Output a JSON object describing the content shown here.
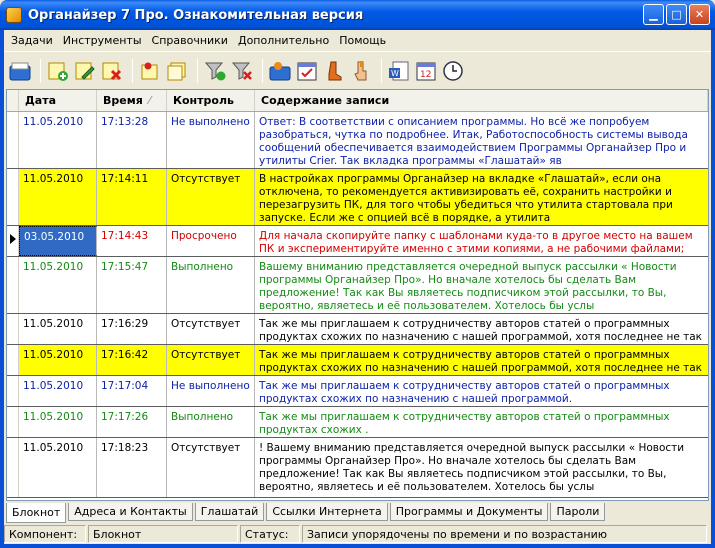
{
  "window": {
    "title": "Органайзер 7 Про. Ознакомительная версия",
    "min_glyph": "▁",
    "max_glyph": "□",
    "close_glyph": "✕"
  },
  "menu": [
    "Задачи",
    "Инструменты",
    "Справочники",
    "Дополнительно",
    "Помощь"
  ],
  "toolbar": {
    "icons": [
      "open-folder-icon",
      "add-note-icon",
      "edit-note-icon",
      "delete-note-icon",
      "pin-note-icon",
      "notes-list-icon",
      "filter-icon",
      "clear-filter-icon",
      "folder-blue-icon",
      "calendar-check-icon",
      "boot-icon",
      "hand-icon",
      "word-export-icon",
      "calendar-12-icon",
      "clock-icon"
    ]
  },
  "grid": {
    "columns": {
      "date": "Дата",
      "time": "Время",
      "control": "Контроль",
      "text": "Содержание записи"
    },
    "sort_glyph": "⁄",
    "rows": [
      {
        "date": "11.05.2010",
        "time": "17:13:28",
        "control": "Не выполнено",
        "text": "Ответ: В соответствии с описанием программы. Но всё же попробуем разобраться, чутка по подробнее. Итак, Работоспособность системы вывода сообщений обеспечивается взаимодействием Программы Органайзер Про и утилиты Crier. Так вкладка программы «Глашатай» яв",
        "color": "blue",
        "highlight": false
      },
      {
        "date": "11.05.2010",
        "time": "17:14:11",
        "control": "Отсутствует",
        "text": "В настройках программы Органайзер на вкладке «Глашатай», если она отключена, то рекомендуется активизировать её, сохранить настройки и перезагрузить ПК, для того чтобы убедиться что утилита стартовала при запуске. Если же с опцией всё в порядке, а утилита",
        "color": "black",
        "highlight": true
      },
      {
        "date": "03.05.2010",
        "time": "17:14:43",
        "control": "Просрочено",
        "text": "Для начала скопируйте папку с шаблонами куда-то в другое место на вашем ПК и экспериментируйте именно с этими копиями, а не рабочими файлами;",
        "color": "red",
        "highlight": false,
        "selected": true
      },
      {
        "date": "11.05.2010",
        "time": "17:15:47",
        "control": "Выполнено",
        "text": "Вашему вниманию представляется очередной выпуск рассылки « Новости программы Органайзер Про». Но вначале хотелось бы сделать Вам предложение! Так как Вы являетесь подписчиком этой рассылки, то Вы, вероятно, являетесь и её пользователем. Хотелось бы услы",
        "color": "green",
        "highlight": false
      },
      {
        "date": "11.05.2010",
        "time": "17:16:29",
        "control": "Отсутствует",
        "text": "Так же мы приглашаем к сотрудничеству авторов статей о программных продуктах схожих по назначению  с нашей программой, хотя последнее не так важно.",
        "color": "black",
        "highlight": false
      },
      {
        "date": "11.05.2010",
        "time": "17:16:42",
        "control": "Отсутствует",
        "text": "Так же мы приглашаем к сотрудничеству авторов статей о программных продуктах схожих по назначению  с нашей программой, хотя последнее не так важно.",
        "color": "black",
        "highlight": true
      },
      {
        "date": "11.05.2010",
        "time": "17:17:04",
        "control": "Не выполнено",
        "text": "Так же мы приглашаем к сотрудничеству авторов статей о программных продуктах схожих по назначению  с нашей программой.",
        "color": "blue",
        "highlight": false
      },
      {
        "date": "11.05.2010",
        "time": "17:17:26",
        "control": "Выполнено",
        "text": "Так же мы приглашаем к сотрудничеству авторов статей о программных продуктах схожих .",
        "color": "green",
        "highlight": false
      },
      {
        "date": "11.05.2010",
        "time": "17:18:23",
        "control": "Отсутствует",
        "text": "! Вашему вниманию представляется очередной выпуск рассылки « Новости программы Органайзер Про». Но вначале хотелось бы сделать Вам предложение! Так как Вы являетесь подписчиком этой рассылки, то Вы, вероятно, являетесь и её пользователем. Хотелось бы услы",
        "color": "black",
        "highlight": false
      }
    ]
  },
  "tabs": [
    "Блокнот",
    "Адреса и Контакты",
    "Глашатай",
    "Ссылки Интернета",
    "Программы и Документы",
    "Пароли"
  ],
  "statusbar": {
    "component_label": "Компонент:",
    "component_value": "Блокнот",
    "status_label": "Статус:",
    "status_value": "Записи упорядочены по времени и по возрастанию"
  },
  "colors": {
    "highlight": "#ffff00",
    "blue_text": "#0b1fa8",
    "green_text": "#138a13",
    "red_text": "#d40000",
    "selection": "#316ac5"
  }
}
